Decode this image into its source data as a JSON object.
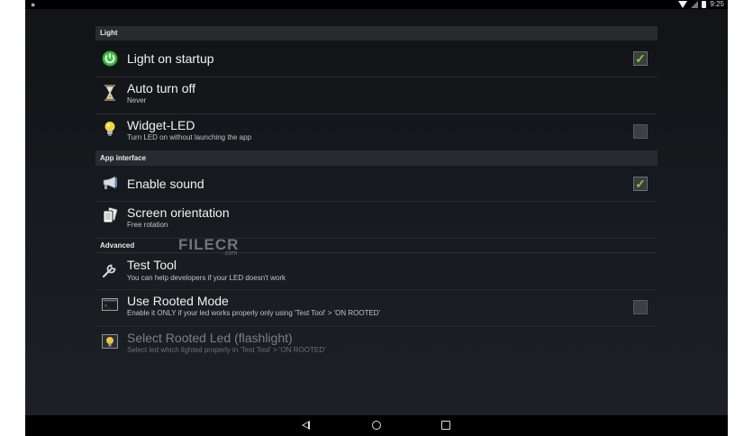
{
  "status_bar": {
    "time": "9:25",
    "icons": [
      "android-icon",
      "wifi-icon",
      "signal-icon",
      "battery-icon"
    ]
  },
  "sections": {
    "light": "Light",
    "app_interface": "App interface",
    "advanced": "Advanced"
  },
  "items": {
    "light_on_startup": {
      "title": "Light on startup",
      "checked": true,
      "icon": "power-icon"
    },
    "auto_turn_off": {
      "title": "Auto turn off",
      "summary": "Never",
      "icon": "hourglass-icon"
    },
    "widget_led": {
      "title": "Widget-LED",
      "summary": "Turn LED on without launching the app",
      "checked": false,
      "icon": "lightbulb-icon"
    },
    "enable_sound": {
      "title": "Enable sound",
      "checked": true,
      "icon": "megaphone-icon"
    },
    "screen_orientation": {
      "title": "Screen orientation",
      "summary": "Free rotation",
      "icon": "rotate-icon"
    },
    "test_tool": {
      "title": "Test Tool",
      "summary": "You can help developers if your LED doesn't work",
      "icon": "wrench-icon"
    },
    "use_rooted_mode": {
      "title": "Use Rooted Mode",
      "summary": "Enable it ONLY if your led works properly only using 'Test Tool' > 'ON ROOTED'",
      "checked": false,
      "icon": "terminal-icon"
    },
    "select_rooted_led": {
      "title": "Select Rooted Led (flashlight)",
      "summary": "Select led which lighted properly in 'Test Tool' > 'ON ROOTED'",
      "icon": "flashlight-icon",
      "disabled": true
    }
  },
  "watermark": {
    "text": "FILECR",
    "suffix": ".com"
  },
  "navigation": {
    "buttons": [
      "back-icon",
      "home-icon",
      "recents-icon"
    ]
  },
  "colors": {
    "checkmark": "#7fd12c",
    "power_icon": "#3fbf3f",
    "background": "#16191d"
  }
}
